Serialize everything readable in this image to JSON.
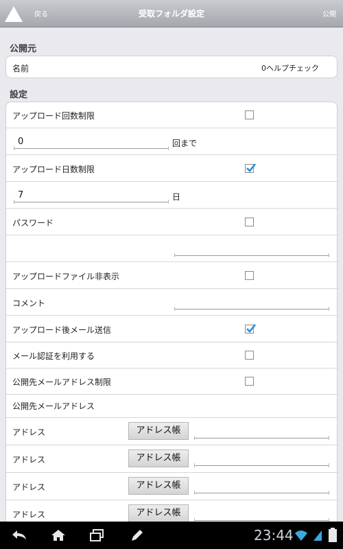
{
  "header": {
    "back_label": "戻る",
    "title": "受取フォルダ設定",
    "publish_label": "公開"
  },
  "publisher": {
    "section_title": "公開元",
    "name_label": "名前",
    "name_value": "0ヘルプチェック"
  },
  "settings": {
    "section_title": "設定",
    "upload_count_limit": {
      "label": "アップロード回数制限",
      "checked": false,
      "value": "0",
      "unit": "回まで"
    },
    "upload_days_limit": {
      "label": "アップロード日数制限",
      "checked": true,
      "value": "7",
      "unit": "日"
    },
    "password": {
      "label": "パスワード",
      "checked": false,
      "value": ""
    },
    "hide_uploaded_files": {
      "label": "アップロードファイル非表示",
      "checked": false
    },
    "comment": {
      "label": "コメント",
      "value": ""
    },
    "mail_after_upload": {
      "label": "アップロード後メール送信",
      "checked": true
    },
    "use_mail_auth": {
      "label": "メール認証を利用する",
      "checked": false
    },
    "restrict_recipient_address": {
      "label": "公開先メールアドレス制限",
      "checked": false
    },
    "recipient_address_header": "公開先メールアドレス",
    "addresses": [
      {
        "label": "アドレス",
        "button": "アドレス帳",
        "value": ""
      },
      {
        "label": "アドレス",
        "button": "アドレス帳",
        "value": ""
      },
      {
        "label": "アドレス",
        "button": "アドレス帳",
        "value": ""
      },
      {
        "label": "アドレス",
        "button": "アドレス帳",
        "value": ""
      }
    ]
  },
  "statusbar": {
    "time": "23:44"
  },
  "colors": {
    "check_blue": "#2a8fd8",
    "topbar": "#b4b6bb"
  }
}
